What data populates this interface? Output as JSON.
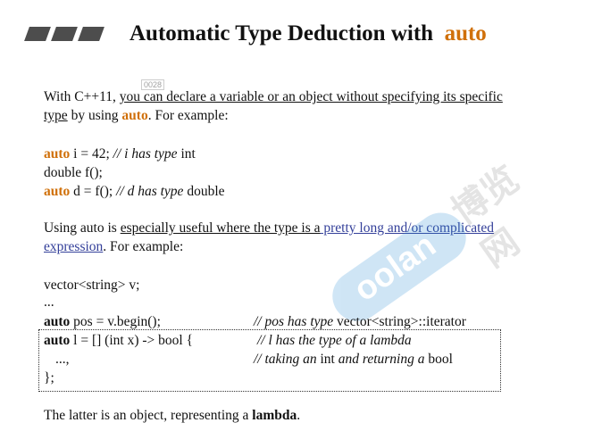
{
  "title": {
    "prefix": "Automatic Type Deduction with",
    "keyword": "auto"
  },
  "page_num": "0028",
  "p1": {
    "l1_a": "With C++11, ",
    "l1_b": "you can declare a variable or an object without specifying its specific",
    "l2_a": "type",
    "l2_b": " by using ",
    "l2_kw": "auto",
    "l2_c": ". For example:"
  },
  "code1": [
    {
      "kw": "auto",
      "text": " i = 42; ",
      "cm": "// i ",
      "cm_it": "has type",
      "tail": " int"
    },
    {
      "kw": "",
      "text": "double f();",
      "cm": "",
      "cm_it": "",
      "tail": ""
    },
    {
      "kw": "auto",
      "text": " d = f(); ",
      "cm": "// d ",
      "cm_it": "has type",
      "tail": " double"
    }
  ],
  "p2": {
    "l1_a": "Using auto is ",
    "l1_b": "especially useful where the type is a",
    "l1_link": " pretty long and/or complicated",
    "l2_link": "expression",
    "l2_c": ". For example:"
  },
  "code2": {
    "l1": "vector<string> v;",
    "l2": "...",
    "l3_kw": "auto",
    "l3_rest": " pos = v.begin();",
    "l3_cm_a": "// pos ",
    "l3_cm_it": "has type",
    "l3_cm_b": " vector<string>::iterator",
    "l4_kw": "auto",
    "l4_rest": " l = [] (int x) -> bool {",
    "l4_cm_a": "// l ",
    "l4_cm_it": "has the type of a lambda",
    "l5_rest": "...,",
    "l5_cm_a": "// ",
    "l5_cm_it": "taking an",
    "l5_cm_b": " int ",
    "l5_cm_it2": "and returning a",
    "l5_cm_c": " bool",
    "l6": "};"
  },
  "p3": {
    "a": "The latter is an object, representing a ",
    "b": "lambda",
    "c": "."
  },
  "watermark": {
    "logo_text": "oolan",
    "cn": "博览网"
  }
}
